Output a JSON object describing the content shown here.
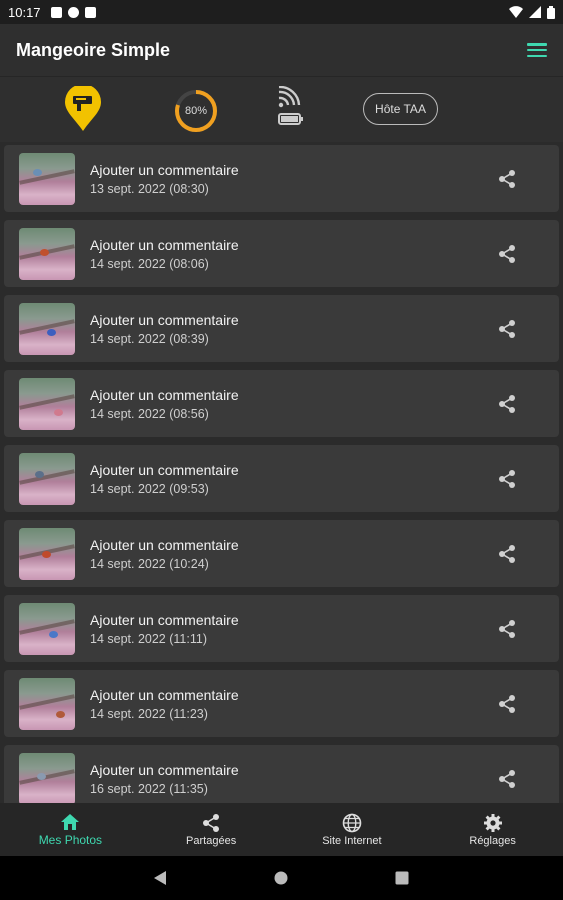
{
  "status_bar": {
    "time": "10:17"
  },
  "app_bar": {
    "title": "Mangeoire Simple"
  },
  "status_row": {
    "battery_gauge_label": "80%",
    "battery_level": 0.8,
    "host_button_label": "Hôte TAA"
  },
  "photos": [
    {
      "comment": "Ajouter un commentaire",
      "date": "13 sept. 2022 (08:30)"
    },
    {
      "comment": "Ajouter un commentaire",
      "date": "14 sept. 2022 (08:06)"
    },
    {
      "comment": "Ajouter un commentaire",
      "date": "14 sept. 2022 (08:39)"
    },
    {
      "comment": "Ajouter un commentaire",
      "date": "14 sept. 2022 (08:56)"
    },
    {
      "comment": "Ajouter un commentaire",
      "date": "14 sept. 2022 (09:53)"
    },
    {
      "comment": "Ajouter un commentaire",
      "date": "14 sept. 2022 (10:24)"
    },
    {
      "comment": "Ajouter un commentaire",
      "date": "14 sept. 2022 (11:11)"
    },
    {
      "comment": "Ajouter un commentaire",
      "date": "14 sept. 2022 (11:23)"
    },
    {
      "comment": "Ajouter un commentaire",
      "date": "16 sept. 2022 (11:35)"
    }
  ],
  "bottom_nav": [
    {
      "label": "Mes Photos",
      "icon": "home-icon"
    },
    {
      "label": "Partagées",
      "icon": "share-icon"
    },
    {
      "label": "Site Internet",
      "icon": "globe-icon"
    },
    {
      "label": "Réglages",
      "icon": "gear-icon"
    }
  ],
  "colors": {
    "accent": "#3fd8b0",
    "gauge": "#f0a020",
    "pin": "#f2c200"
  }
}
